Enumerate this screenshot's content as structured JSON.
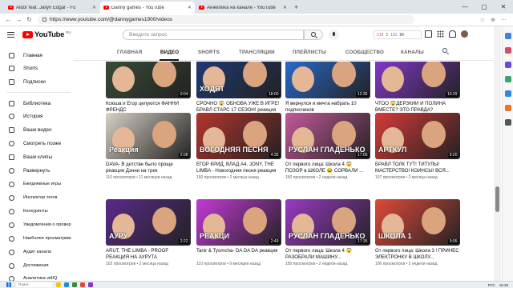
{
  "browser": {
    "tabs": [
      {
        "title": "Aldor feat. Jailyn Edgar - Fo",
        "active": false
      },
      {
        "title": "Danny games - YouTube",
        "active": true
      },
      {
        "title": "Aнжелика на канале - YouTube",
        "active": false
      }
    ],
    "url": "https://www.youtube.com/@dannygames1900/videos",
    "new_tab": "+",
    "window_controls": [
      "—",
      "▢",
      "✕"
    ],
    "nav": [
      "←",
      "→",
      "↻"
    ],
    "ext_icons": [
      "☆",
      "⊕",
      "⋯"
    ]
  },
  "youtube": {
    "logo": "YouTube",
    "country": "RU",
    "search_placeholder": "Введите запрос",
    "stats": [
      "219",
      "2",
      "131",
      "8K"
    ]
  },
  "sidebar": {
    "items": [
      {
        "label": "Главная",
        "icon": "home-icon"
      },
      {
        "label": "Shorts",
        "icon": "shorts-icon"
      },
      {
        "label": "Подписки",
        "icon": "subscriptions-icon"
      },
      {
        "label": "Библиотека",
        "icon": "library-icon"
      },
      {
        "label": "История",
        "icon": "history-icon"
      },
      {
        "label": "Ваши видео",
        "icon": "your-videos-icon"
      },
      {
        "label": "Смотреть позже",
        "icon": "watch-later-icon"
      },
      {
        "label": "Ваши клипы",
        "icon": "clips-icon"
      },
      {
        "label": "Развернуть",
        "icon": "chevron-down-icon"
      },
      {
        "label": "Ежедневные игры",
        "icon": "channel-avatar-icon"
      },
      {
        "label": "Инспектор тегов",
        "icon": "channel-avatar-icon"
      },
      {
        "label": "Конкуренты",
        "icon": "channel-avatar-icon"
      },
      {
        "label": "Уведомления о проверке",
        "icon": "channel-avatar-icon"
      },
      {
        "label": "Наиболее просматриваемые",
        "icon": "channel-avatar-icon"
      },
      {
        "label": "Аудит канала",
        "icon": "channel-avatar-icon"
      },
      {
        "label": "Достижения",
        "icon": "channel-avatar-icon"
      },
      {
        "label": "Аналитика vidIQ",
        "icon": "channel-avatar-icon"
      }
    ]
  },
  "channel_tabs": [
    "ГЛАВНАЯ",
    "ВИДЕО",
    "SHORTS",
    "ТРАНСЛЯЦИИ",
    "ПЛЕЙЛИСТЫ",
    "СООБЩЕСТВО",
    "КАНАЛЫ"
  ],
  "active_tab": "ВИДЕО",
  "videos": [
    {
      "title": "Ксюша и Егор целуются ФАННИ ФРЕНДС",
      "meta": "111 просмотров • 9 месяцев назад",
      "duration": "0:04",
      "overlay": "",
      "bg": "#3a4f3a"
    },
    {
      "title": "СРОЧНО 😱 ОБНОВА УЖЕ В ИГРЕ! БРАВЛ СТАРС 17 СЕЗОН! реакция",
      "meta": "150 просмотров • 2 недели назад",
      "duration": "18:00",
      "overlay": "ХОДЯТ",
      "bg": "#1f3b7a"
    },
    {
      "title": "Я вернулся и мечта набрать 10 подписчиков",
      "meta": "108 просмотров • 2 года назад",
      "duration": "12:36",
      "overlay": "",
      "bg": "#2a6fd6"
    },
    {
      "title": "ЧТОО 😱ДЕРЗКИЙ И ПОЛИНА ВМЕСТЕ? ЭТО ПРАВДА?",
      "meta": "107 просмотров • 2 недели назад",
      "duration": "10:29",
      "overlay": "",
      "bg": "#8a3ad6"
    },
    {
      "title": "DAVA- В детстве было проще реакция Дэнни на трек",
      "meta": "110 просмотров • 11 месяцев назад",
      "duration": "2:08",
      "overlay": "Реакция",
      "bg": "#d8d0c4"
    },
    {
      "title": "ЕГОР КРИД, ВЛАД А4, JONY, THE LIMBA - Новогодняя песня реакция",
      "meta": "150 просмотров • 2 месяца назад",
      "duration": "4:35",
      "overlay": "ВОГОДНЯЯ ПЕСНЯ",
      "bg": "#b5342e"
    },
    {
      "title": "От первого лица: Школа 4 😱 ПОЗОР в ШКОЛЕ 😂 СОРВАЛИ ...",
      "meta": "150 просмотров • 2 недели назад",
      "duration": "17:06",
      "overlay": "РУСЛАН ГЛАДЕНЬКО",
      "bg": "#c45a9a"
    },
    {
      "title": "БРАВЛ ТОЛК ТУТ! ТИТУЛЫ! МАСТЕРСТВО! КОИНСЫ! ВСЯ...",
      "meta": "107 просмотров • 2 месяца назад",
      "duration": "9:20",
      "overlay": "АРТКУЛ",
      "bg": "#d63a3a"
    },
    {
      "title": "ARUT, THE LIMBA - PROOF РЕАКЦИЯ НА АУРУТА",
      "meta": "102 просмотров • 2 месяца назад",
      "duration": "2:22",
      "overlay": "АУРУ",
      "bg": "#5a2a8a"
    },
    {
      "title": "Tanir & Tyomcha- DA DA DA реакция",
      "meta": "110 просмотров • 9 месяцев назад",
      "duration": "2:49",
      "overlay": "РЕАКЦИ",
      "bg": "#c43ad6"
    },
    {
      "title": "От первого лица: Школа 4 😱 РАЗОБРАЛИ МАШИНУ...",
      "meta": "150 просмотров • 2 недели назад",
      "duration": "17:35",
      "overlay": "РУСЛАН ГЛАДЕНЬКО",
      "bg": "#9a3ac4"
    },
    {
      "title": "От первого лица: Школа 3 ! ПРИНЕС ЭЛЕКТРОНКУ В ШКОЛУ...",
      "meta": "100 просмотров • 2 недели назад",
      "duration": "9:05",
      "overlay": "ШКОЛА 1",
      "bg": "#e04a3a"
    }
  ],
  "taskbar": {
    "search": "Поиск",
    "lang": "РУС",
    "time": "16:36"
  },
  "colors": {
    "accent": "#ff0000",
    "text": "#0f0f0f",
    "muted": "#606060"
  }
}
